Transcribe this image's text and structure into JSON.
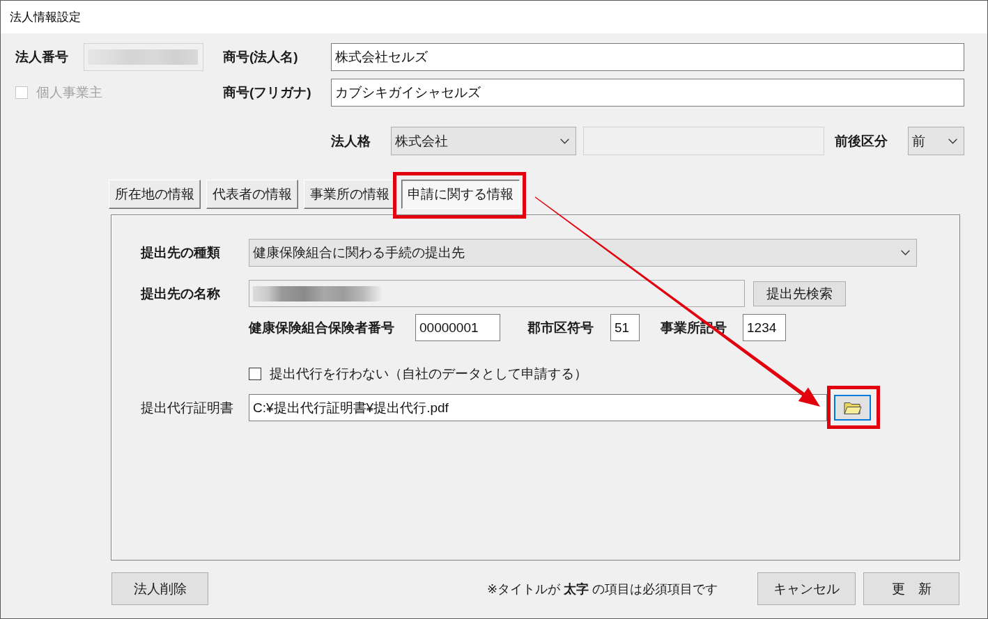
{
  "window": {
    "title": "法人情報設定"
  },
  "header": {
    "corporate_number": {
      "label": "法人番号",
      "required": true,
      "disabled": true,
      "redacted": true
    },
    "sole_proprietor": {
      "label": "個人事業主",
      "checked": false,
      "disabled": true
    },
    "trade_name": {
      "label": "商号(法人名)",
      "required": true,
      "value": "株式会社セルズ"
    },
    "trade_name_kana": {
      "label": "商号(フリガナ)",
      "required": true,
      "value": "カブシキガイシャセルズ"
    },
    "corporate_type": {
      "label": "法人格",
      "required": true,
      "value": "株式会社"
    },
    "corporate_type_other": {
      "disabled": true
    },
    "position": {
      "label": "前後区分",
      "required": true,
      "value": "前"
    }
  },
  "tabs": [
    {
      "label": "所在地の情報",
      "selected": false,
      "highlighted": false
    },
    {
      "label": "代表者の情報",
      "selected": false,
      "highlighted": false
    },
    {
      "label": "事業所の情報",
      "selected": false,
      "highlighted": false
    },
    {
      "label": "申請に関する情報",
      "selected": true,
      "highlighted": true
    }
  ],
  "panel": {
    "submission_type": {
      "label": "提出先の種類",
      "required": true,
      "value": "健康保険組合に関わる手続の提出先"
    },
    "submission_name": {
      "label": "提出先の名称",
      "required": true,
      "read_only": true,
      "redacted": true
    },
    "search_button": "提出先検索",
    "insurer_number": {
      "label": "健康保険組合保険者番号",
      "required": true,
      "value": "00000001"
    },
    "city_code": {
      "label": "郡市区符号",
      "required": true,
      "value": "51"
    },
    "office_code": {
      "label": "事業所記号",
      "required": true,
      "value": "1234"
    },
    "no_proxy": {
      "label": "提出代行を行わない（自社のデータとして申請する）",
      "checked": false
    },
    "proxy_certificate": {
      "label": "提出代行証明書",
      "required": false,
      "value": "C:¥提出代行証明書¥提出代行.pdf",
      "browse_focused": true,
      "browse_highlighted": true
    }
  },
  "footer": {
    "delete_button": "法人削除",
    "note": "※タイトルが **太字** の項目は必須項目です",
    "cancel_button": "キャンセル",
    "update_button": "更　新"
  }
}
